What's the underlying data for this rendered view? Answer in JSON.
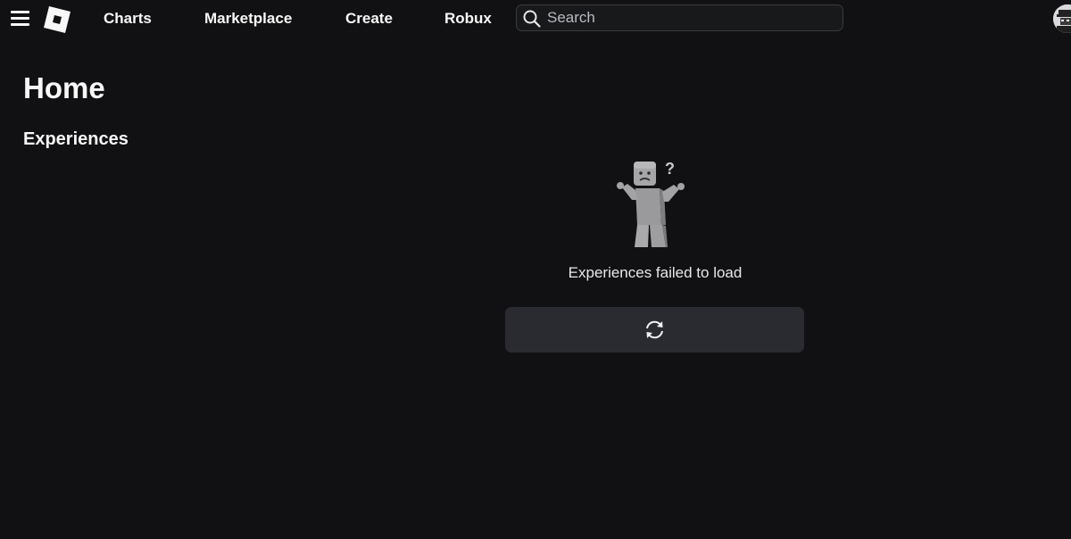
{
  "header": {
    "nav": {
      "charts": "Charts",
      "marketplace": "Marketplace",
      "create": "Create",
      "robux": "Robux"
    },
    "search": {
      "placeholder": "Search"
    }
  },
  "main": {
    "title": "Home",
    "section_title": "Experiences",
    "error": {
      "message": "Experiences failed to load"
    }
  },
  "icons": {
    "menu": "hamburger-menu-icon",
    "logo": "roblox-logo",
    "search": "search-icon",
    "reload": "reload-icon",
    "avatar": "avatar",
    "error": "confused-avatar-illustration"
  },
  "colors": {
    "background": "#111113",
    "text": "#f7f7f8",
    "button": "#2a2b30",
    "search_border": "#3a3b3f"
  }
}
